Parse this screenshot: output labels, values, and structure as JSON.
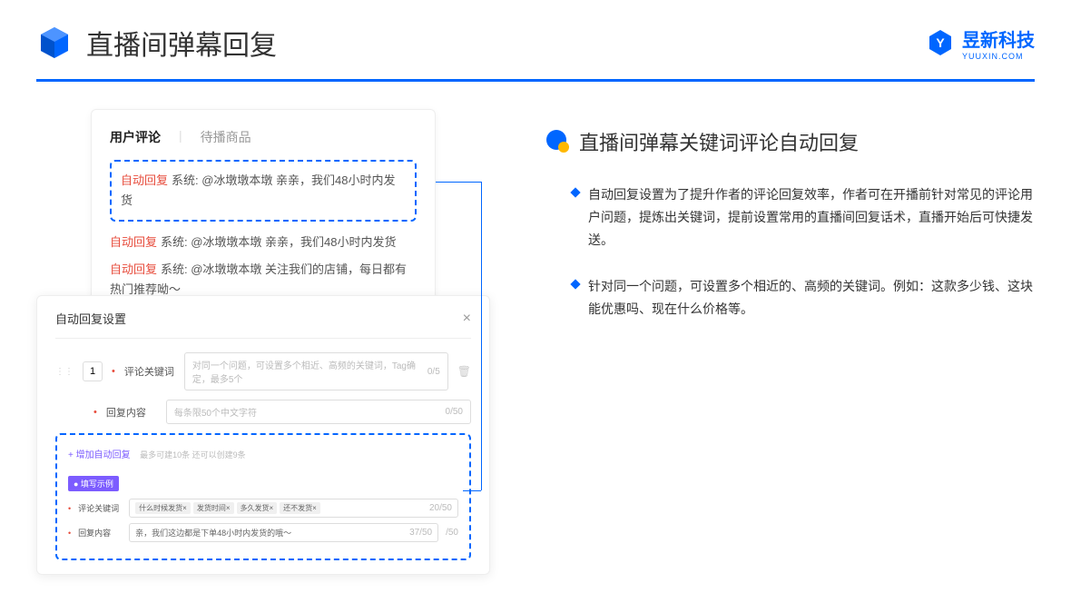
{
  "header": {
    "title": "直播间弹幕回复",
    "logo_main": "昱新科技",
    "logo_sub": "YUUXIN.COM"
  },
  "card1": {
    "tab1": "用户评论",
    "tab2": "待播商品",
    "reply1": "系统: @冰墩墩本墩 亲亲，我们48小时内发货",
    "reply2": "系统: @冰墩墩本墩 亲亲，我们48小时内发货",
    "reply3": "系统: @冰墩墩本墩 关注我们的店铺，每日都有热门推荐呦～",
    "auto_tag": "自动回复"
  },
  "card2": {
    "title": "自动回复设置",
    "num": "1",
    "label1": "评论关键词",
    "placeholder1": "对同一个问题，可设置多个相近、高频的关键词，Tag确定，最多5个",
    "count1": "0/5",
    "label2": "回复内容",
    "placeholder2": "每条限50个中文字符",
    "count2": "0/50",
    "add_link": "+ 增加自动回复",
    "hint": "最多可建10条 还可以创建9条",
    "example_badge": "● 填写示例",
    "ex_label1": "评论关键词",
    "tags": [
      "什么时候发货×",
      "发货时间×",
      "多久发货×",
      "还不发货×"
    ],
    "ex_count1": "20/50",
    "ex_label2": "回复内容",
    "ex_value2": "亲，我们这边都是下单48小时内发货的哦～",
    "ex_count2": "37/50",
    "side_count": "/50"
  },
  "right": {
    "section_title": "直播间弹幕关键词评论自动回复",
    "bullet1": "自动回复设置为了提升作者的评论回复效率，作者可在开播前针对常见的评论用户问题，提炼出关键词，提前设置常用的直播间回复话术，直播开始后可快捷发送。",
    "bullet2": "针对同一个问题，可设置多个相近的、高频的关键词。例如：这款多少钱、这块能优惠吗、现在什么价格等。"
  }
}
